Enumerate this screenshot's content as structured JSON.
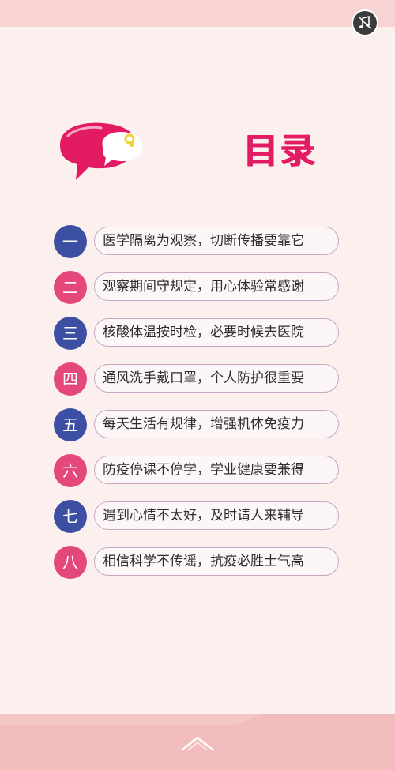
{
  "header": {
    "title": "目录",
    "music_icon": "music-note-icon"
  },
  "toc": [
    {
      "num": "一",
      "text": "医学隔离为观察，切断传播要靠它",
      "color": "#3d4fa3"
    },
    {
      "num": "二",
      "text": "观察期间守规定，用心体验常感谢",
      "color": "#e4487a"
    },
    {
      "num": "三",
      "text": "核酸体温按时检，必要时候去医院",
      "color": "#3d4fa3"
    },
    {
      "num": "四",
      "text": "通风洗手戴口罩，个人防护很重要",
      "color": "#e4487a"
    },
    {
      "num": "五",
      "text": "每天生活有规律，增强机体免疫力",
      "color": "#3d4fa3"
    },
    {
      "num": "六",
      "text": "防疫停课不停学，学业健康要兼得",
      "color": "#e4487a"
    },
    {
      "num": "七",
      "text": "遇到心情不太好，及时请人来辅导",
      "color": "#3d4fa3"
    },
    {
      "num": "八",
      "text": "相信科学不传谣，抗疫必胜士气高",
      "color": "#e4487a"
    }
  ],
  "footer": {
    "swipe_icon": "chevron-up-icon"
  },
  "colors": {
    "accent": "#e31b63",
    "blue": "#3d4fa3",
    "pink": "#e4487a",
    "background": "#fbe4e4"
  }
}
